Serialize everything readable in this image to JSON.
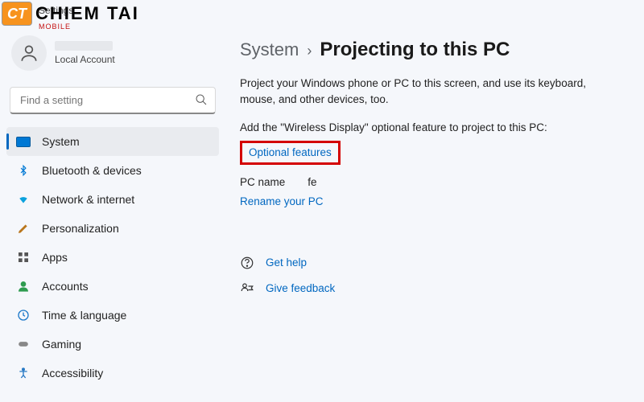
{
  "window": {
    "title": "Settings"
  },
  "watermark": {
    "brand": "CHIEM TAI",
    "sub": "MOBILE",
    "badge": "CT"
  },
  "account": {
    "type": "Local Account"
  },
  "search": {
    "placeholder": "Find a setting"
  },
  "sidebar": {
    "items": [
      {
        "label": "System",
        "selected": true
      },
      {
        "label": "Bluetooth & devices"
      },
      {
        "label": "Network & internet"
      },
      {
        "label": "Personalization"
      },
      {
        "label": "Apps"
      },
      {
        "label": "Accounts"
      },
      {
        "label": "Time & language"
      },
      {
        "label": "Gaming"
      },
      {
        "label": "Accessibility"
      }
    ]
  },
  "breadcrumb": {
    "parent": "System",
    "sep": "›",
    "current": "Projecting to this PC"
  },
  "main": {
    "description": "Project your Windows phone or PC to this screen, and use its keyboard, mouse, and other devices, too.",
    "feature_line": "Add the \"Wireless Display\" optional feature to project to this PC:",
    "optional_link": "Optional features",
    "pcname_label": "PC name",
    "pcname_value": "fe",
    "rename_link": "Rename your PC",
    "help_link": "Get help",
    "feedback_link": "Give feedback"
  }
}
